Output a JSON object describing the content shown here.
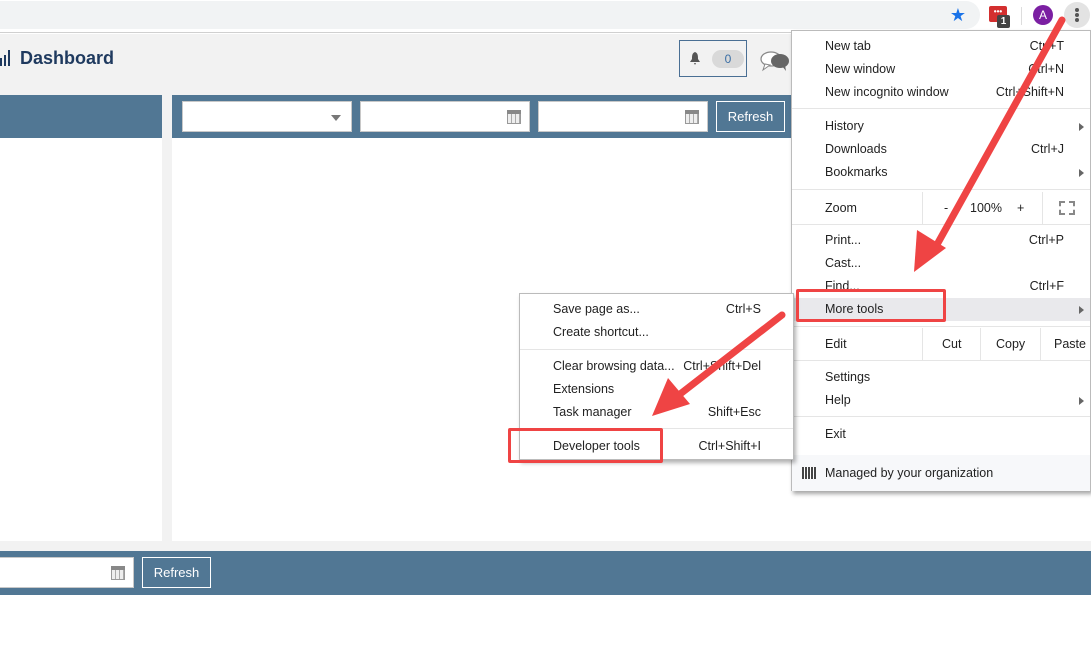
{
  "browser": {
    "bookmark_icon": "star-icon",
    "extension_icon": "calendar-extension-icon",
    "extension_badge": "1",
    "profile_initial": "A",
    "menu_icon": "kebab-menu-icon"
  },
  "app": {
    "title": "Dashboard",
    "logo_icon": "bar-chart-icon",
    "notifications": {
      "icon": "bell-icon",
      "count": "0"
    },
    "chat_icon": "chat-bubbles-icon"
  },
  "filters": {
    "select_value": "",
    "date_from": "",
    "date_to": "",
    "refresh_label": "Refresh"
  },
  "bottom_filters": {
    "date_value": "",
    "refresh_label": "Refresh"
  },
  "chrome_menu": {
    "items": [
      {
        "label": "New tab",
        "shortcut": "Ctrl+T"
      },
      {
        "label": "New window",
        "shortcut": "Ctrl+N"
      },
      {
        "label": "New incognito window",
        "shortcut": "Ctrl+Shift+N"
      },
      {
        "label": "History",
        "shortcut": ""
      },
      {
        "label": "Downloads",
        "shortcut": "Ctrl+J"
      },
      {
        "label": "Bookmarks",
        "shortcut": ""
      },
      {
        "label": "Print...",
        "shortcut": "Ctrl+P"
      },
      {
        "label": "Cast...",
        "shortcut": ""
      },
      {
        "label": "Find...",
        "shortcut": "Ctrl+F"
      },
      {
        "label": "More tools",
        "shortcut": ""
      },
      {
        "label": "Settings",
        "shortcut": ""
      },
      {
        "label": "Help",
        "shortcut": ""
      },
      {
        "label": "Exit",
        "shortcut": ""
      }
    ],
    "zoom": {
      "label": "Zoom",
      "minus": "-",
      "value": "100%",
      "plus": "+"
    },
    "edit": {
      "label": "Edit",
      "cut": "Cut",
      "copy": "Copy",
      "paste": "Paste"
    },
    "managed": "Managed by your organization"
  },
  "more_tools_menu": {
    "items": [
      {
        "label": "Save page as...",
        "shortcut": "Ctrl+S"
      },
      {
        "label": "Create shortcut...",
        "shortcut": ""
      },
      {
        "label": "Clear browsing data...",
        "shortcut": "Ctrl+Shift+Del"
      },
      {
        "label": "Extensions",
        "shortcut": ""
      },
      {
        "label": "Task manager",
        "shortcut": "Shift+Esc"
      },
      {
        "label": "Developer tools",
        "shortcut": "Ctrl+Shift+I"
      }
    ]
  },
  "annotations": {
    "color": "#ef4444",
    "highlighted": [
      "More tools",
      "Developer tools"
    ]
  }
}
